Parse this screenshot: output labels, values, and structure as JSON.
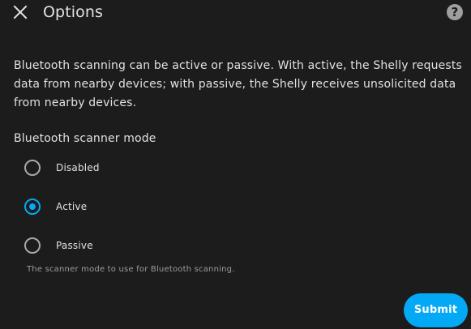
{
  "dialog": {
    "title": "Options",
    "help_icon": "help-circle-icon",
    "close_icon": "close-icon",
    "description": "Bluetooth scanning can be active or passive. With active, the Shelly requests data from nearby devices; with passive, the Shelly receives unsolicited data from nearby devices.",
    "field_label": "Bluetooth scanner mode",
    "options": [
      {
        "label": "Disabled",
        "checked": false
      },
      {
        "label": "Active",
        "checked": true
      },
      {
        "label": "Passive",
        "checked": false
      }
    ],
    "helper_text": "The scanner mode to use for Bluetooth scanning.",
    "submit_label": "Submit",
    "accent_color": "#03a9f4"
  }
}
